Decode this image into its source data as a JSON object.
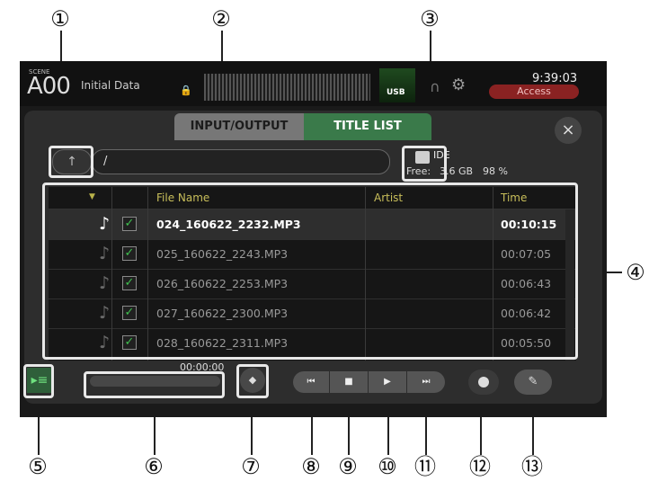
{
  "header": {
    "scene_label": "SCENE",
    "scene_number": "A00",
    "scene_title": "Initial Data",
    "usb_icon": "USB",
    "clock": "9:39:03",
    "access": "Access"
  },
  "tabs": {
    "input_output": "INPUT/OUTPUT",
    "title_list": "TITLE LIST"
  },
  "close_label": "×",
  "path": {
    "up_icon": "↑",
    "value": "/"
  },
  "drive": {
    "name": "IDE",
    "free_label": "Free:",
    "free_value": "3.6 GB",
    "percent": "98 %"
  },
  "table": {
    "sort_icon": "▼",
    "columns": {
      "file_name": "File Name",
      "artist": "Artist",
      "time": "Time"
    },
    "rows": [
      {
        "file": "024_160622_2232.MP3",
        "artist": "",
        "time": "00:10:15",
        "selected": true
      },
      {
        "file": "025_160622_2243.MP3",
        "artist": "",
        "time": "00:07:05",
        "selected": false
      },
      {
        "file": "026_160622_2253.MP3",
        "artist": "",
        "time": "00:06:43",
        "selected": false
      },
      {
        "file": "027_160622_2300.MP3",
        "artist": "",
        "time": "00:06:42",
        "selected": false
      },
      {
        "file": "028_160622_2311.MP3",
        "artist": "",
        "time": "00:05:50",
        "selected": false
      }
    ]
  },
  "transport": {
    "elapsed": "00:00:00",
    "prev": "⏮",
    "stop": "■",
    "play": "▶",
    "next": "⏭",
    "edit": "✎"
  },
  "callouts": [
    "①",
    "②",
    "③",
    "④",
    "⑤",
    "⑥",
    "⑦",
    "⑧",
    "⑨",
    "⑩",
    "⑪",
    "⑫",
    "⑬"
  ]
}
